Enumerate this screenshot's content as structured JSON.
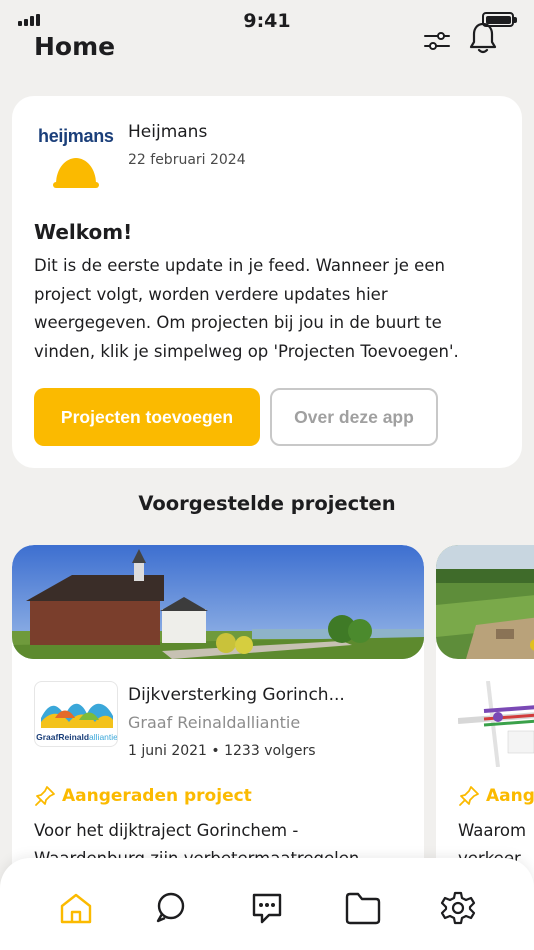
{
  "status_bar": {
    "time": "9:41"
  },
  "header": {
    "title": "Home"
  },
  "welcome_post": {
    "brand_wordmark": "heijmans",
    "author": "Heijmans",
    "date": "22 februari 2024",
    "heading": "Welkom!",
    "body": "Dit is de eerste update in je feed. Wanneer je een project volgt, worden verdere updates hier weergegeven. Om projecten bij jou in de buurt te vinden, klik je simpelweg op 'Projecten Toevoegen'.",
    "primary_button": "Projecten toevoegen",
    "secondary_button": "Over deze app"
  },
  "suggested": {
    "title": "Voorgestelde projecten",
    "projects": [
      {
        "title": "Dijkversterking Gorinch...",
        "org": "Graaf Reinaldalliantie",
        "org_logo_text_a": "Graaf",
        "org_logo_text_b": "Reinald",
        "org_logo_text_c": "alliantie",
        "meta": "1 juni 2021 • 1233 volgers",
        "badge": "Aangeraden project",
        "description": "Voor het dijktraject Gorinchem - Waardenburg zijn verbetermaatregelen"
      },
      {
        "badge": "Aang",
        "description": "Waarom\nverkeer"
      }
    ]
  },
  "nav": [
    "home-tab",
    "search-tab",
    "messages-tab",
    "projects-tab",
    "settings-tab"
  ],
  "colors": {
    "accent": "#fbba00",
    "background": "#f1f0ee",
    "brand_blue": "#1b3f7a"
  }
}
